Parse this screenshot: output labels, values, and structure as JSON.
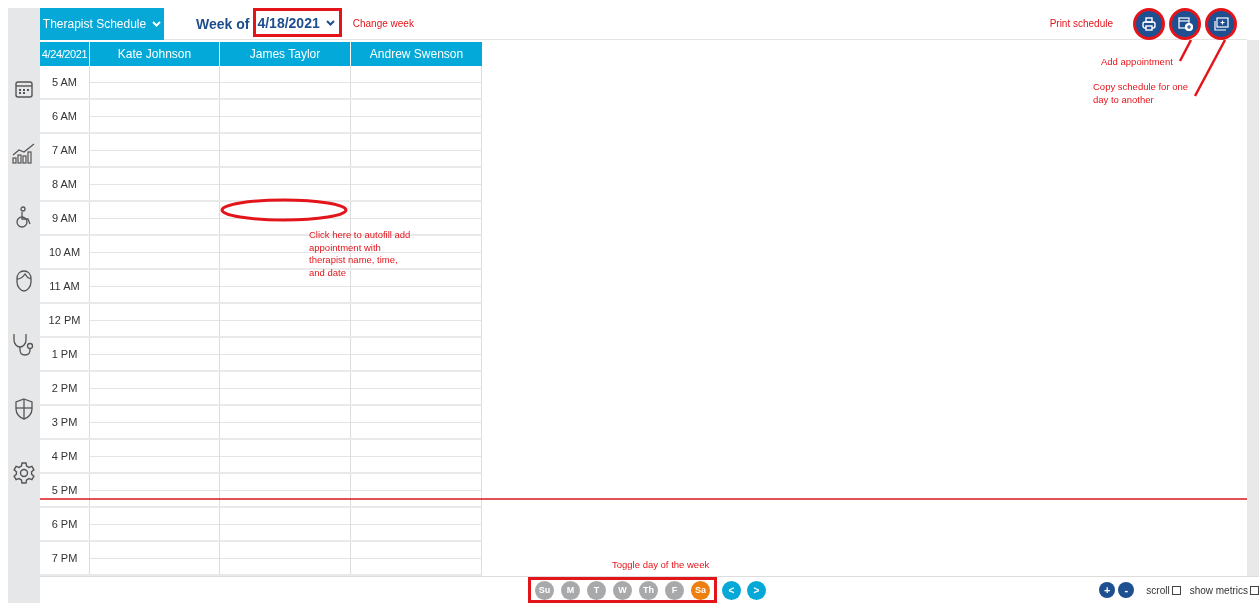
{
  "sidebar": {
    "items": [
      {
        "kind": "calendar"
      },
      {
        "kind": "chart"
      },
      {
        "kind": "wheelchair"
      },
      {
        "kind": "face"
      },
      {
        "kind": "stethoscope"
      },
      {
        "kind": "shield"
      },
      {
        "kind": "gear"
      }
    ]
  },
  "toolbar": {
    "view_menu": "Therapist Schedule",
    "week_label": "Week of",
    "week_date": "4/18/2021",
    "actions": [
      {
        "kind": "print"
      },
      {
        "kind": "add"
      },
      {
        "kind": "copy"
      }
    ]
  },
  "schedule": {
    "date": "4/24/2021",
    "columns": [
      "Kate Johnson",
      "James Taylor",
      "Andrew Swenson"
    ],
    "times": [
      "5 AM",
      "6 AM",
      "7 AM",
      "8 AM",
      "9 AM",
      "10 AM",
      "11 AM",
      "12 PM",
      "1 PM",
      "2 PM",
      "3 PM",
      "4 PM",
      "5 PM",
      "6 PM",
      "7 PM"
    ]
  },
  "days": [
    {
      "label": "Su",
      "selected": false
    },
    {
      "label": "M",
      "selected": false
    },
    {
      "label": "T",
      "selected": false
    },
    {
      "label": "W",
      "selected": false
    },
    {
      "label": "Th",
      "selected": false
    },
    {
      "label": "F",
      "selected": false
    },
    {
      "label": "Sa",
      "selected": true
    }
  ],
  "nav": [
    "<",
    ">"
  ],
  "zoom": [
    "+",
    "-"
  ],
  "options": [
    {
      "label": "scroll",
      "checked": false
    },
    {
      "label": "show metrics",
      "checked": false
    }
  ],
  "annotations": {
    "change_week": "Change week",
    "print": "Print schedule",
    "add": "Add appointment",
    "copy": "Copy schedule for one day to another",
    "autofill": "Click here to autofill add appointment with therapist name, time, and date",
    "toggle": "Toggle day of the week"
  }
}
